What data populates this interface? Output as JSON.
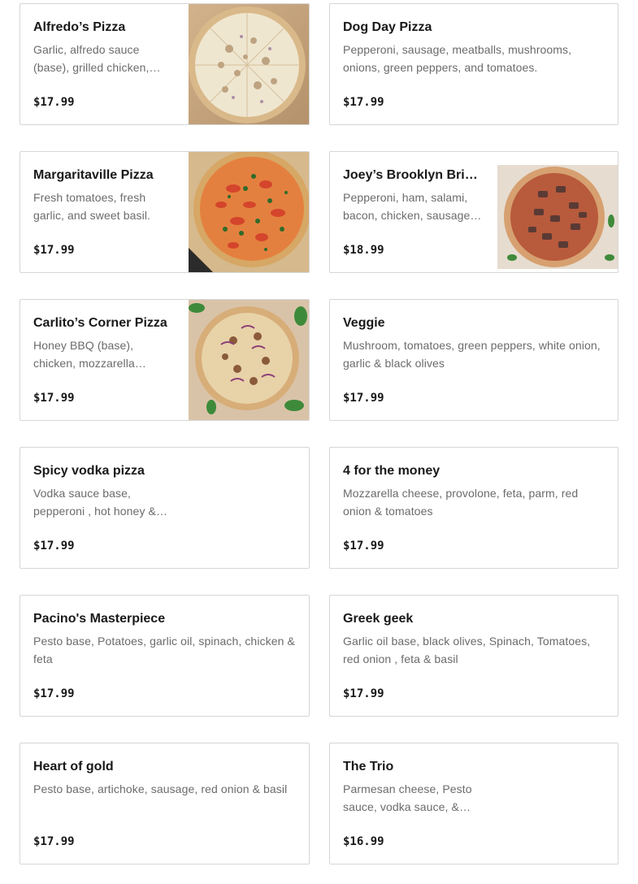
{
  "menu": {
    "items": [
      {
        "name": "Alfredo’s Pizza",
        "description": "Garlic, alfredo sauce (base), grilled chicken,…",
        "price": "$17.99",
        "image": "alfredo-pizza-photo"
      },
      {
        "name": "Dog Day Pizza",
        "description": "Pepperoni, sausage, meatballs, mushrooms, onions, green peppers, and tomatoes.",
        "price": "$17.99"
      },
      {
        "name": "Margaritaville Pizza",
        "description": "Fresh tomatoes, fresh garlic, and sweet basil.",
        "price": "$17.99",
        "image": "margaritaville-pizza-photo"
      },
      {
        "name": "Joey’s Brooklyn Bridg…",
        "description": "Pepperoni, ham, salami, bacon, chicken, sausage …",
        "price": "$18.99",
        "image": "brooklyn-bridge-pizza-photo"
      },
      {
        "name": "Carlito’s Corner Pizza",
        "description": "Honey BBQ (base), chicken, mozzarella cheese, red…",
        "price": "$17.99",
        "image": "carlitos-corner-pizza-photo"
      },
      {
        "name": "Veggie",
        "description": "Mushroom, tomatoes, green peppers, white onion, garlic & black olives",
        "price": "$17.99"
      },
      {
        "name": "Spicy vodka pizza",
        "description": "Vodka sauce base, pepperoni , hot honey &…",
        "price": "$17.99"
      },
      {
        "name": "4 for the money",
        "description": "Mozzarella cheese, provolone, feta, parm, red onion & tomatoes",
        "price": "$17.99"
      },
      {
        "name": "Pacino's Masterpiece",
        "description": "Pesto base, Potatoes, garlic oil, spinach, chicken & feta",
        "price": "$17.99"
      },
      {
        "name": "Greek geek",
        "description": "Garlic oil base, black olives, Spinach, Tomatoes, red onion , feta & basil",
        "price": "$17.99"
      },
      {
        "name": "Heart of gold",
        "description": "Pesto base, artichoke, sausage, red onion & basil",
        "price": "$17.99"
      },
      {
        "name": "The Trio",
        "description": "Parmesan cheese, Pesto sauce, vodka sauce, &…",
        "price": "$16.99"
      }
    ]
  }
}
